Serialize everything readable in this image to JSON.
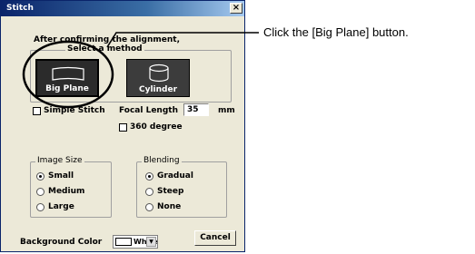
{
  "dialog": {
    "title": "Stitch",
    "close_glyph": "×",
    "instruction": "After confirming the alignment,",
    "method_group": {
      "legend": "Select a method",
      "big_plane_label": "Big Plane",
      "cylinder_label": "Cylinder"
    },
    "simple_stitch_label": "Simple Stitch",
    "focal_length": {
      "label": "Focal Length",
      "value": "35",
      "unit": "mm"
    },
    "degree_360_label": "360 degree",
    "image_size": {
      "legend": "Image Size",
      "options": [
        "Small",
        "Medium",
        "Large"
      ],
      "selected": "Small"
    },
    "blending": {
      "legend": "Blending",
      "options": [
        "Gradual",
        "Steep",
        "None"
      ],
      "selected": "Gradual"
    },
    "background_color": {
      "label": "Background Color",
      "value": "White",
      "dropdown_glyph": "▼"
    },
    "cancel_label": "Cancel"
  },
  "annotation": {
    "text": "Click the [Big Plane] button."
  }
}
